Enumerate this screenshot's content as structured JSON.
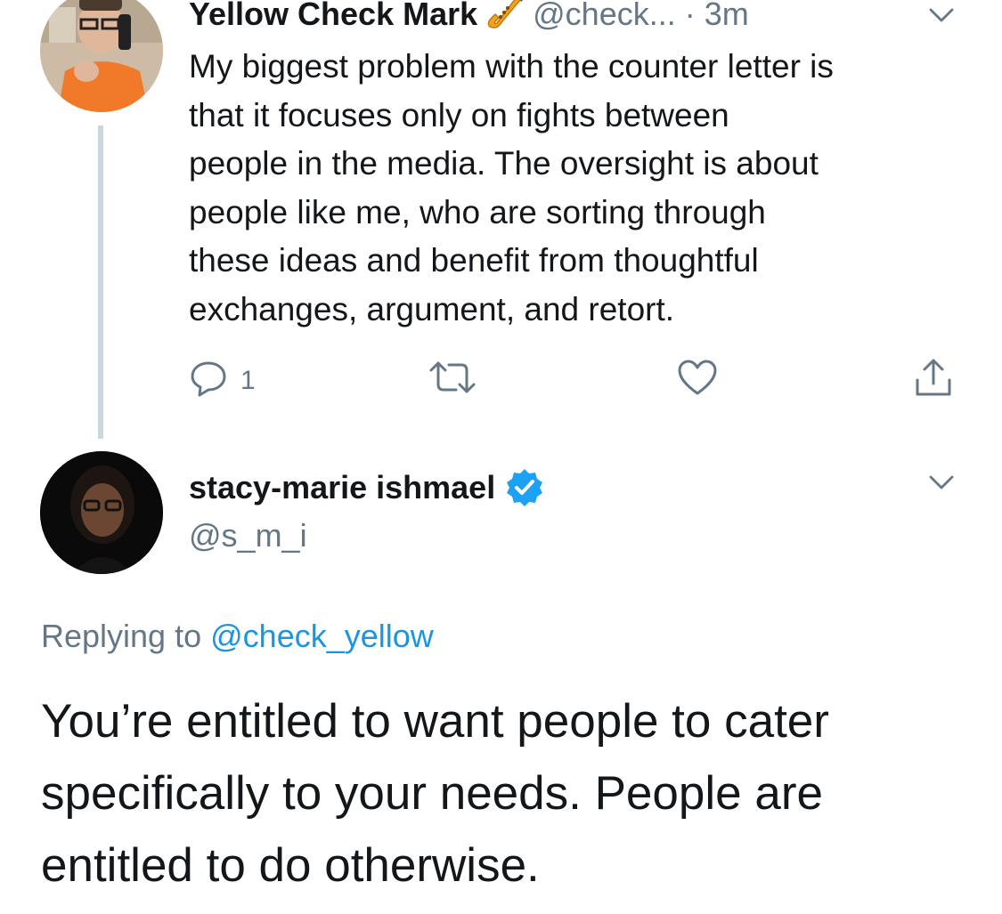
{
  "parent_tweet": {
    "display_name": "Yellow Check Mark",
    "badge_emoji_icon": "saxophone-icon",
    "handle": "@check...",
    "separator": "·",
    "time": "3m",
    "text": "My biggest problem with the counter letter is\nthat it focuses only on fights between\npeople in the media.  The oversight is about\npeople like me, who are sorting through\nthese ideas and benefit from thoughtful\nexchanges, argument, and retort.",
    "reply_count": "1",
    "icons": [
      "reply-icon",
      "retweet-icon",
      "like-icon",
      "share-icon",
      "chevron-down-icon"
    ]
  },
  "reply_tweet": {
    "display_name": "stacy-marie ishmael",
    "verified_icon": "verified-badge-icon",
    "handle": "@s_m_i",
    "replying_prefix": "Replying to",
    "replying_to": "@check_yellow",
    "text": "You’re entitled to want people to cater specifically to your needs. People are entitled to do otherwise."
  },
  "colors": {
    "primary_text": "#14171a",
    "secondary_text": "#657786",
    "link": "#1b95e0",
    "verified": "#1da1f2",
    "thread_line": "#ccd6dd"
  }
}
